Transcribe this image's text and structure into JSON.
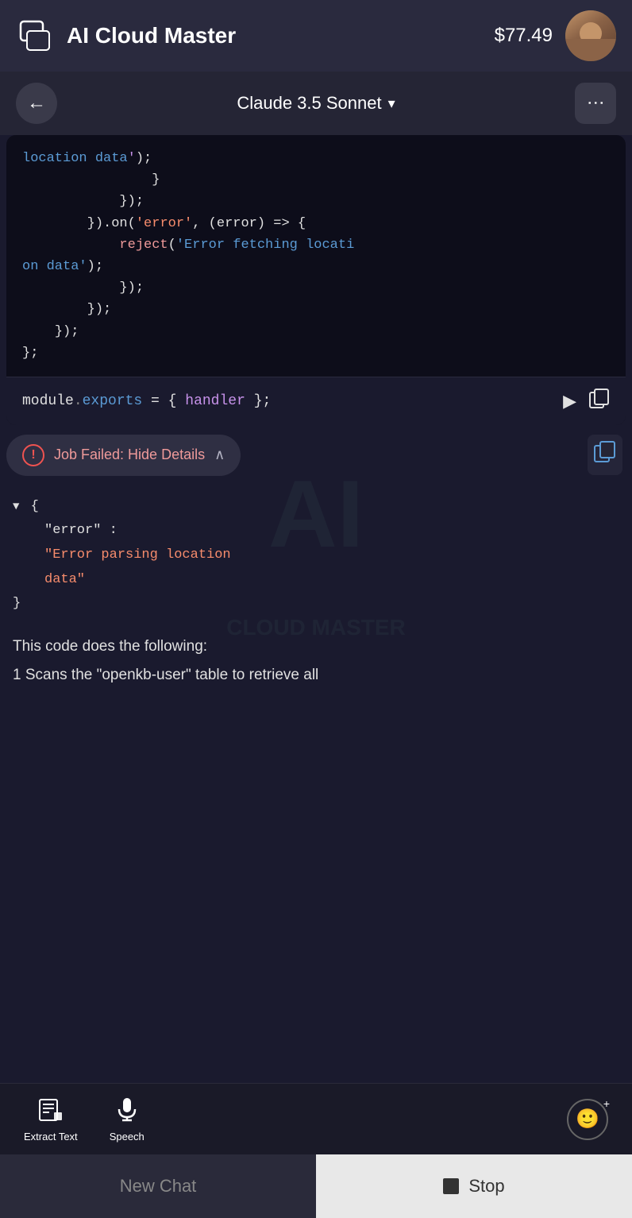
{
  "header": {
    "chat_icon": "💬",
    "title": "AI Cloud Master",
    "price": "$77.49",
    "avatar_alt": "User avatar"
  },
  "nav": {
    "model_name": "Claude 3.5 Sonnet",
    "back_label": "←",
    "more_label": "⋮"
  },
  "code_block": {
    "lines": [
      "location data');",
      "            }",
      "        });",
      "    }).on('error', (error) => {",
      "        reject('Error fetching locati",
      "on data');",
      "        });",
      "    });",
      "};"
    ],
    "footer_text": "module.exports = { handler };",
    "run_icon": "▶",
    "copy_icon": "⧉"
  },
  "job_failed": {
    "error_icon": "!",
    "label": "Job Failed: Hide Details",
    "chevron": "∧"
  },
  "json_error": {
    "error_key": "\"error\" :",
    "error_value": "\"Error parsing location data\""
  },
  "description": {
    "text": "This code does the following:",
    "item1": "1  Scans the \"openkb-user\" table to retrieve all"
  },
  "toolbar": {
    "extract_text_icon": "⊞",
    "extract_text_label": "Extract Text",
    "speech_icon": "🎤",
    "speech_label": "Speech",
    "emoji_icon": "🙂",
    "emoji_plus": "+"
  },
  "bottom_buttons": {
    "new_chat": "New Chat",
    "stop": "Stop"
  },
  "watermark": {
    "text": "AI",
    "subtitle": "CLOUD MASTER"
  }
}
